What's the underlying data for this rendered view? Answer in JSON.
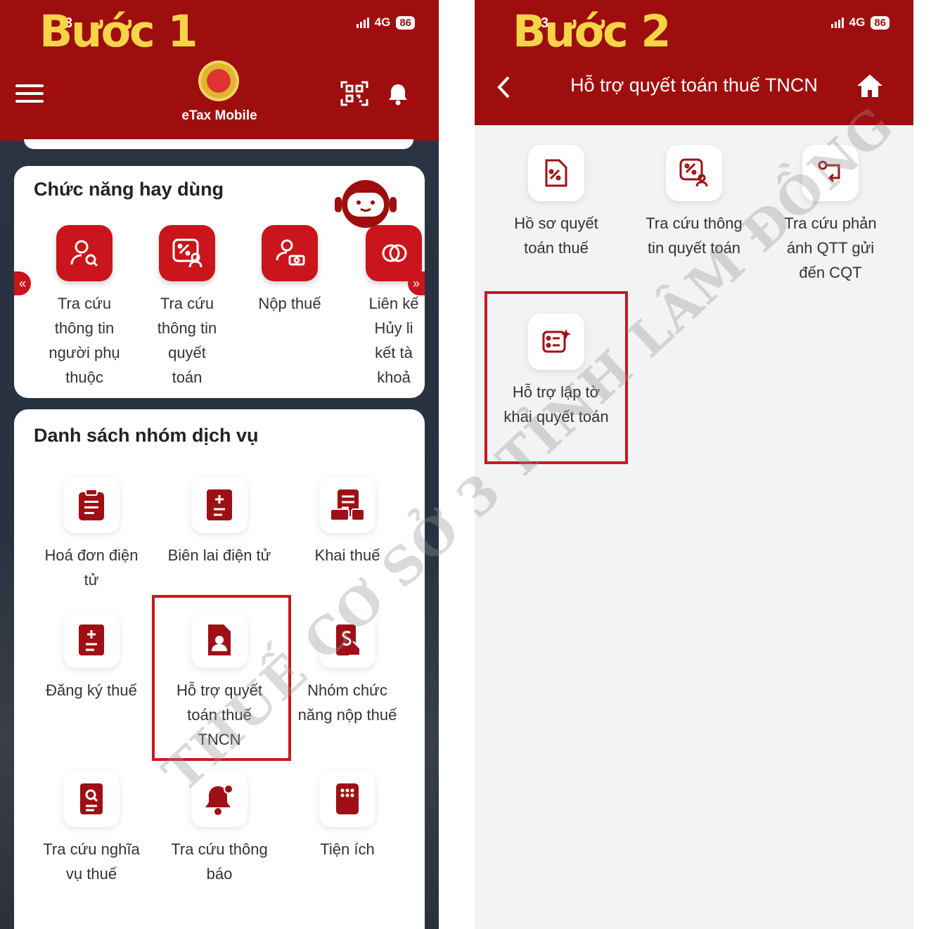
{
  "phone1": {
    "step_title": "Bước 1",
    "status": {
      "time": "3",
      "network": "4G",
      "battery": "86"
    },
    "header": {
      "brand": "eTax Mobile"
    },
    "favorites": {
      "title": "Chức năng hay dùng",
      "items": [
        {
          "label": "Tra cứu\nthông tin\nngười phụ\nthuộc",
          "icon": "user-search-icon"
        },
        {
          "label": "Tra cứu\nthông tin\nquyết\ntoán",
          "icon": "tax-settlement-icon"
        },
        {
          "label": "Nộp thuế",
          "icon": "pay-tax-icon"
        },
        {
          "label": "Liên kế\nHủy li\nkết tà\nkhoả",
          "icon": "link-icon"
        }
      ],
      "prev_arrow": "«",
      "next_arrow": "»"
    },
    "services": {
      "title": "Danh sách nhóm dịch vụ",
      "items": [
        {
          "label": "Hoá đơn điện\ntử",
          "icon": "invoice-icon"
        },
        {
          "label": "Biên lai điện tử",
          "icon": "receipt-icon"
        },
        {
          "label": "Khai thuế",
          "icon": "tax-declaration-icon"
        },
        {
          "label": "Đăng ký thuế",
          "icon": "tax-registration-icon"
        },
        {
          "label": "Hỗ trợ quyết\ntoán thuế\nTNCN",
          "icon": "personal-tax-icon"
        },
        {
          "label": "Nhóm chức\nnăng nộp thuế",
          "icon": "tax-payment-group-icon"
        },
        {
          "label": "Tra cứu nghĩa\nvụ thuế",
          "icon": "tax-obligation-icon"
        },
        {
          "label": "Tra cứu thông\nbáo",
          "icon": "notification-icon"
        },
        {
          "label": "Tiện ích",
          "icon": "utilities-icon"
        }
      ]
    }
  },
  "phone2": {
    "step_title": "Bước 2",
    "status": {
      "time": "3",
      "network": "4G",
      "battery": "86"
    },
    "header": {
      "title": "Hỗ trợ quyết toán thuế TNCN"
    },
    "items": [
      {
        "label": "Hồ sơ quyết\ntoán thuế",
        "icon": "settlement-file-icon"
      },
      {
        "label": "Tra cứu thông\ntin quyết toán",
        "icon": "settlement-search-icon"
      },
      {
        "label": "Tra cứu phản\nánh QTT gửi\nđến CQT",
        "icon": "feedback-icon"
      },
      {
        "label": "Hỗ trợ lập tờ\nkhai quyết toán",
        "icon": "declaration-form-icon"
      }
    ]
  },
  "watermark": "THUẾ CƠ SỞ 3 TỈNH LÂM ĐỒNG",
  "colors": {
    "header_red": "#9e0e0e",
    "tile_red": "#c9151b",
    "step_yellow": "#f5d547",
    "highlight": "#c8191f"
  }
}
